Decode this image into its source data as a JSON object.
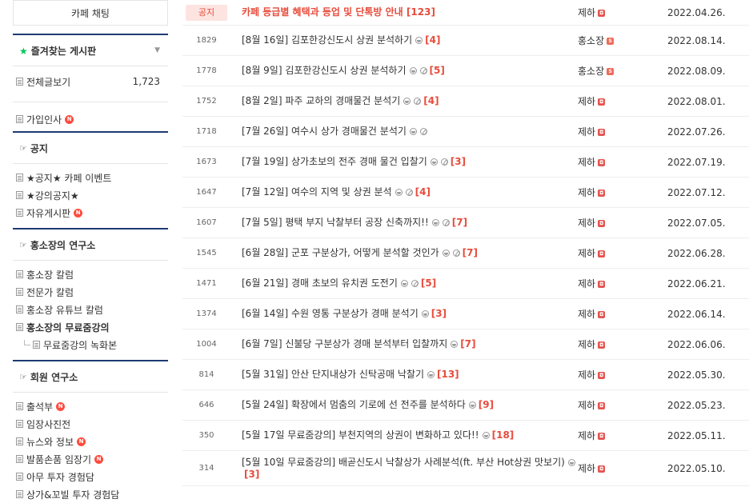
{
  "sidebar": {
    "cafe_chat": "카페 채팅",
    "favorites_title": "즐겨찾는 게시판",
    "all_posts_label": "전체글보기",
    "all_posts_count": "1,723",
    "join_greeting": "가입인사",
    "new_badge": "N",
    "sections": [
      {
        "title": "공지",
        "items": [
          {
            "label": "★공지★ 카페 이벤트",
            "new": false
          },
          {
            "label": "★강의공지★",
            "new": false
          },
          {
            "label": "자유게시판",
            "new": true
          }
        ]
      },
      {
        "title": "홍소장의 연구소",
        "items": [
          {
            "label": "홍소장 칼럼",
            "new": false
          },
          {
            "label": "전문가 칼럼",
            "new": false
          },
          {
            "label": "홍소장 유튜브 칼럼",
            "new": false
          },
          {
            "label": "홍소장의 무료줌강의",
            "new": false,
            "bold": true
          },
          {
            "label": "무료줌강의 녹화본",
            "new": false,
            "sub": true
          }
        ]
      },
      {
        "title": "회원 연구소",
        "items": [
          {
            "label": "출석부",
            "new": true
          },
          {
            "label": "임장사진전",
            "new": false
          },
          {
            "label": "뉴스와 정보",
            "new": true
          },
          {
            "label": "발품손품 임장기",
            "new": true
          },
          {
            "label": "아무 투자 경험담",
            "new": false
          },
          {
            "label": "상가&꼬빌 투자 경험담",
            "new": false
          }
        ]
      }
    ]
  },
  "notice": {
    "tag": "공지",
    "title": "카페 등급별 혜택과 등업 및 단톡방 안내",
    "comments": "[123]",
    "author": "제하",
    "level": "m",
    "level_glyph": "◘",
    "date": "2022.04.26."
  },
  "posts": [
    {
      "num": "1829",
      "title": "[8월 16일] 김포한강신도시 상권 분석하기",
      "icons": [
        "img"
      ],
      "comments": "[4]",
      "author": "홍소장",
      "level": "s",
      "level_glyph": "S",
      "date": "2022.08.14."
    },
    {
      "num": "1778",
      "title": "[8월 9일] 김포한강신도시 상권 분석하기",
      "icons": [
        "img",
        "att"
      ],
      "comments": "[5]",
      "author": "홍소장",
      "level": "s",
      "level_glyph": "S",
      "date": "2022.08.09."
    },
    {
      "num": "1752",
      "title": "[8월 2일] 파주 교하의 경매물건 분석기",
      "icons": [
        "img",
        "att"
      ],
      "comments": "[4]",
      "author": "제하",
      "level": "m",
      "level_glyph": "◘",
      "date": "2022.08.01."
    },
    {
      "num": "1718",
      "title": "[7월 26일] 여수시 상가 경매물건 분석기",
      "icons": [
        "img",
        "att"
      ],
      "comments": "",
      "author": "제하",
      "level": "m",
      "level_glyph": "◘",
      "date": "2022.07.26."
    },
    {
      "num": "1673",
      "title": "[7월 19일] 상가초보의 전주 경매 물건 입찰기",
      "icons": [
        "img",
        "att"
      ],
      "comments": "[3]",
      "author": "제하",
      "level": "m",
      "level_glyph": "◘",
      "date": "2022.07.19."
    },
    {
      "num": "1647",
      "title": "[7월 12일] 여수의 지역 및 상권 분석",
      "icons": [
        "img",
        "att"
      ],
      "comments": "[4]",
      "author": "제하",
      "level": "m",
      "level_glyph": "◘",
      "date": "2022.07.12."
    },
    {
      "num": "1607",
      "title": "[7월 5일] 평택 부지 낙찰부터 공장 신축까지!!",
      "icons": [
        "img",
        "att"
      ],
      "comments": "[7]",
      "author": "제하",
      "level": "m",
      "level_glyph": "◘",
      "date": "2022.07.05."
    },
    {
      "num": "1545",
      "title": "[6월 28일] 군포 구분상가, 어떻게 분석할 것인가",
      "icons": [
        "img",
        "att"
      ],
      "comments": "[7]",
      "author": "제하",
      "level": "m",
      "level_glyph": "◘",
      "date": "2022.06.28."
    },
    {
      "num": "1471",
      "title": "[6월 21일] 경매 초보의 유치권 도전기",
      "icons": [
        "img",
        "att"
      ],
      "comments": "[5]",
      "author": "제하",
      "level": "m",
      "level_glyph": "◘",
      "date": "2022.06.21."
    },
    {
      "num": "1374",
      "title": "[6월 14일] 수원 영통 구분상가 경매 분석기",
      "icons": [
        "img"
      ],
      "comments": "[3]",
      "author": "제하",
      "level": "m",
      "level_glyph": "◘",
      "date": "2022.06.14."
    },
    {
      "num": "1004",
      "title": "[6월 7일] 신불당 구분상가 경매 분석부터 입찰까지",
      "icons": [
        "img"
      ],
      "comments": "[7]",
      "author": "제하",
      "level": "m",
      "level_glyph": "◘",
      "date": "2022.06.06."
    },
    {
      "num": "814",
      "title": "[5월 31일] 안산 단지내상가 신탁공매 낙찰기",
      "icons": [
        "img"
      ],
      "comments": "[13]",
      "author": "제하",
      "level": "m",
      "level_glyph": "◘",
      "date": "2022.05.30."
    },
    {
      "num": "646",
      "title": "[5월 24일] 확장에서 멈춤의 기로에 선 전주를 분석하다",
      "icons": [
        "img"
      ],
      "comments": "[9]",
      "author": "제하",
      "level": "m",
      "level_glyph": "◘",
      "date": "2022.05.23."
    },
    {
      "num": "350",
      "title": "[5월 17일 무료줌강의] 부천지역의 상권이 변화하고 있다!!",
      "icons": [
        "img"
      ],
      "comments": "[18]",
      "author": "제하",
      "level": "m",
      "level_glyph": "◘",
      "date": "2022.05.11."
    },
    {
      "num": "314",
      "title": "[5월 10일 무료줌강의] 배곧신도시 낙찰상가 사례분석(ft. 부산 Hot상권 맛보기)",
      "icons": [
        "img"
      ],
      "comments": "[3]",
      "author": "제하",
      "level": "m",
      "level_glyph": "◘",
      "date": "2022.05.10."
    }
  ]
}
